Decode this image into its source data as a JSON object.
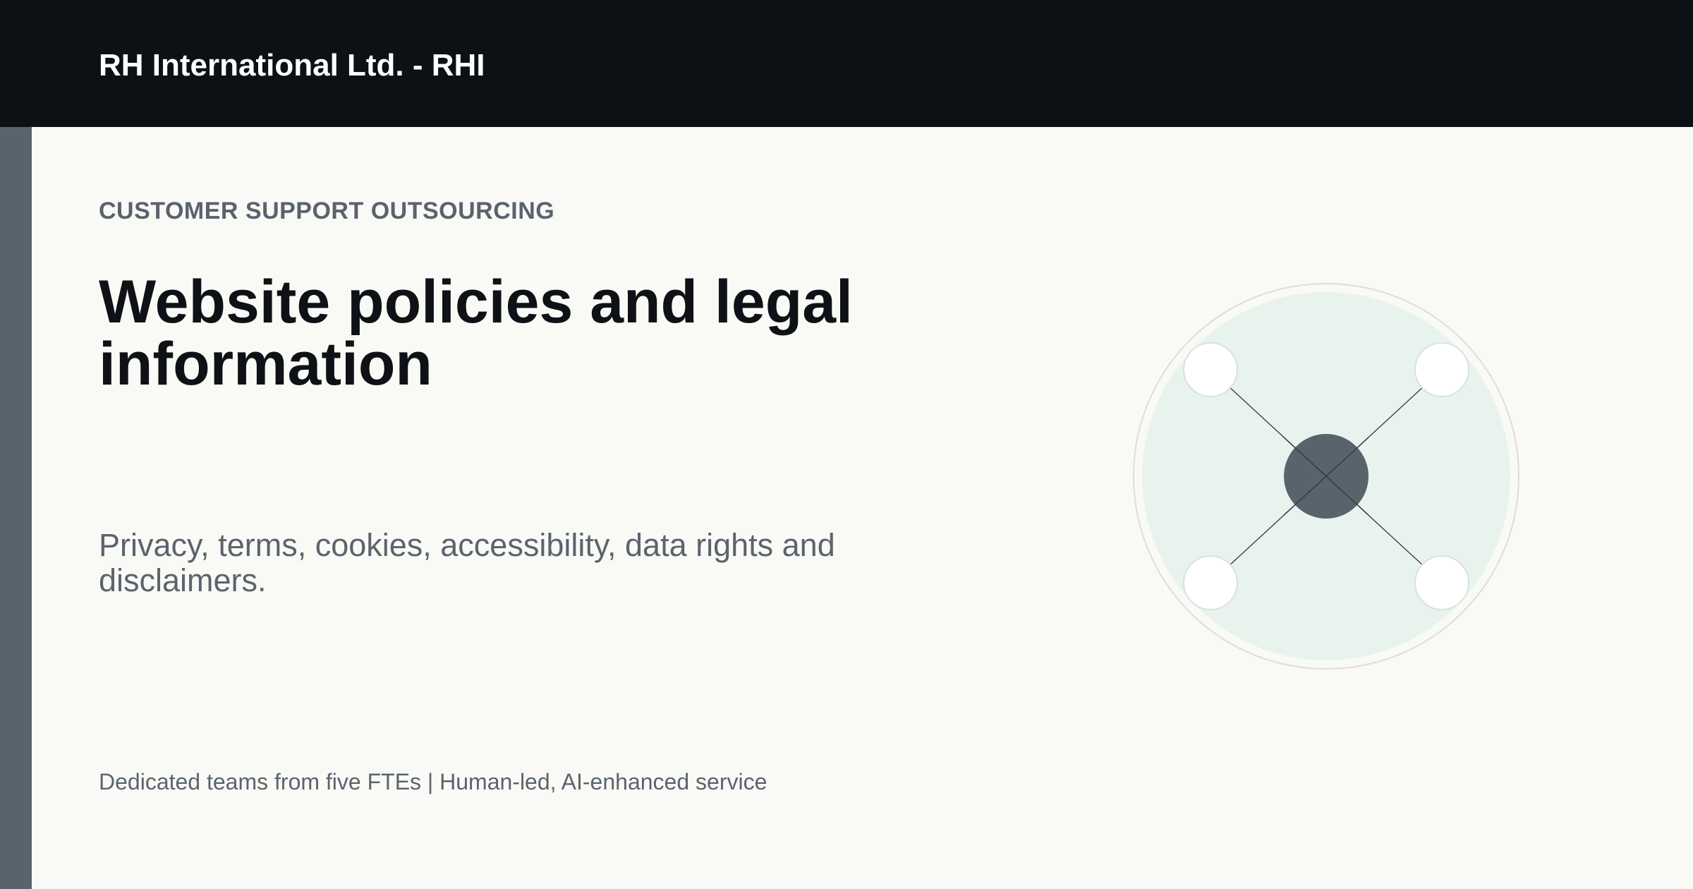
{
  "header": {
    "brand": "RH International Ltd. - RHI"
  },
  "hero": {
    "eyebrow": "CUSTOMER SUPPORT OUTSOURCING",
    "title": "Website policies and legal information",
    "subtitle": "Privacy, terms, cookies, accessibility, data rights and disclaimers.",
    "footnote": "Dedicated teams from five FTEs | Human-led, AI-enhanced service"
  },
  "colors": {
    "topbar": "#0d1115",
    "rail": "#59636b",
    "background": "#f9faf6",
    "hub": "#59636b",
    "disc": "#e9f3ee"
  },
  "illustration": {
    "icon": "network-hub-icon"
  }
}
